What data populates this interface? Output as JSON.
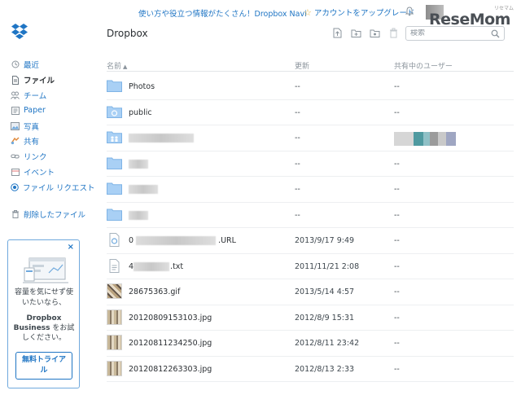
{
  "topbar": {
    "navi_link": "使い方や役立つ情報がたくさん！Dropbox Navi",
    "upgrade": "アカウントをアップグレード",
    "watermark_sub": "リセマム",
    "watermark": "ReseMom"
  },
  "sidebar": {
    "items": [
      {
        "label": "最近",
        "icon": "clock-icon"
      },
      {
        "label": "ファイル",
        "icon": "file-icon",
        "active": true
      },
      {
        "label": "チーム",
        "icon": "team-icon"
      },
      {
        "label": "Paper",
        "icon": "paper-icon"
      },
      {
        "label": "写真",
        "icon": "photo-icon"
      },
      {
        "label": "共有",
        "icon": "share-icon"
      },
      {
        "label": "リンク",
        "icon": "link-icon"
      },
      {
        "label": "イベント",
        "icon": "calendar-icon"
      },
      {
        "label": "ファイル リクエスト",
        "icon": "file-request-icon"
      }
    ],
    "deleted": "削除したファイル"
  },
  "promo": {
    "line1": "容量を気にせず使いたいなら、",
    "brand": "Dropbox Business",
    "line2": "をお試しください。",
    "trial_button": "無料トライアル"
  },
  "main": {
    "title": "Dropbox",
    "search_placeholder": "検索",
    "columns": {
      "name": "名前",
      "modified": "更新",
      "shared": "共有中のユーザー"
    },
    "rows": [
      {
        "type": "folder",
        "name": "Photos",
        "modified": "--",
        "shared": "--"
      },
      {
        "type": "public-folder",
        "name": "public",
        "modified": "--",
        "shared": "--"
      },
      {
        "type": "shared-folder",
        "name": "",
        "modified": "--",
        "shared": ""
      },
      {
        "type": "folder",
        "name": "",
        "modified": "--",
        "shared": "--"
      },
      {
        "type": "folder",
        "name": "",
        "modified": "--",
        "shared": "--"
      },
      {
        "type": "folder",
        "name": "",
        "modified": "--",
        "shared": "--"
      },
      {
        "type": "url-file",
        "prefix": "0",
        "name": ".URL",
        "modified": "2013/9/17 9:49",
        "shared": "--"
      },
      {
        "type": "txt-file",
        "prefix": "4",
        "name": ".txt",
        "modified": "2011/11/21 2:08",
        "shared": "--"
      },
      {
        "type": "image",
        "name": "28675363.gif",
        "modified": "2013/5/14 4:57",
        "shared": "--"
      },
      {
        "type": "image",
        "name": "20120809153103.jpg",
        "modified": "2012/8/9 15:31",
        "shared": "--"
      },
      {
        "type": "image",
        "name": "20120811234250.jpg",
        "modified": "2012/8/11 23:42",
        "shared": "--"
      },
      {
        "type": "image",
        "name": "20120812263303.jpg",
        "modified": "2012/8/13 2:33",
        "shared": "--"
      }
    ]
  },
  "colors": {
    "accent": "#1f75c4",
    "folder": "#9ec9ef",
    "text": "#3d464d"
  }
}
